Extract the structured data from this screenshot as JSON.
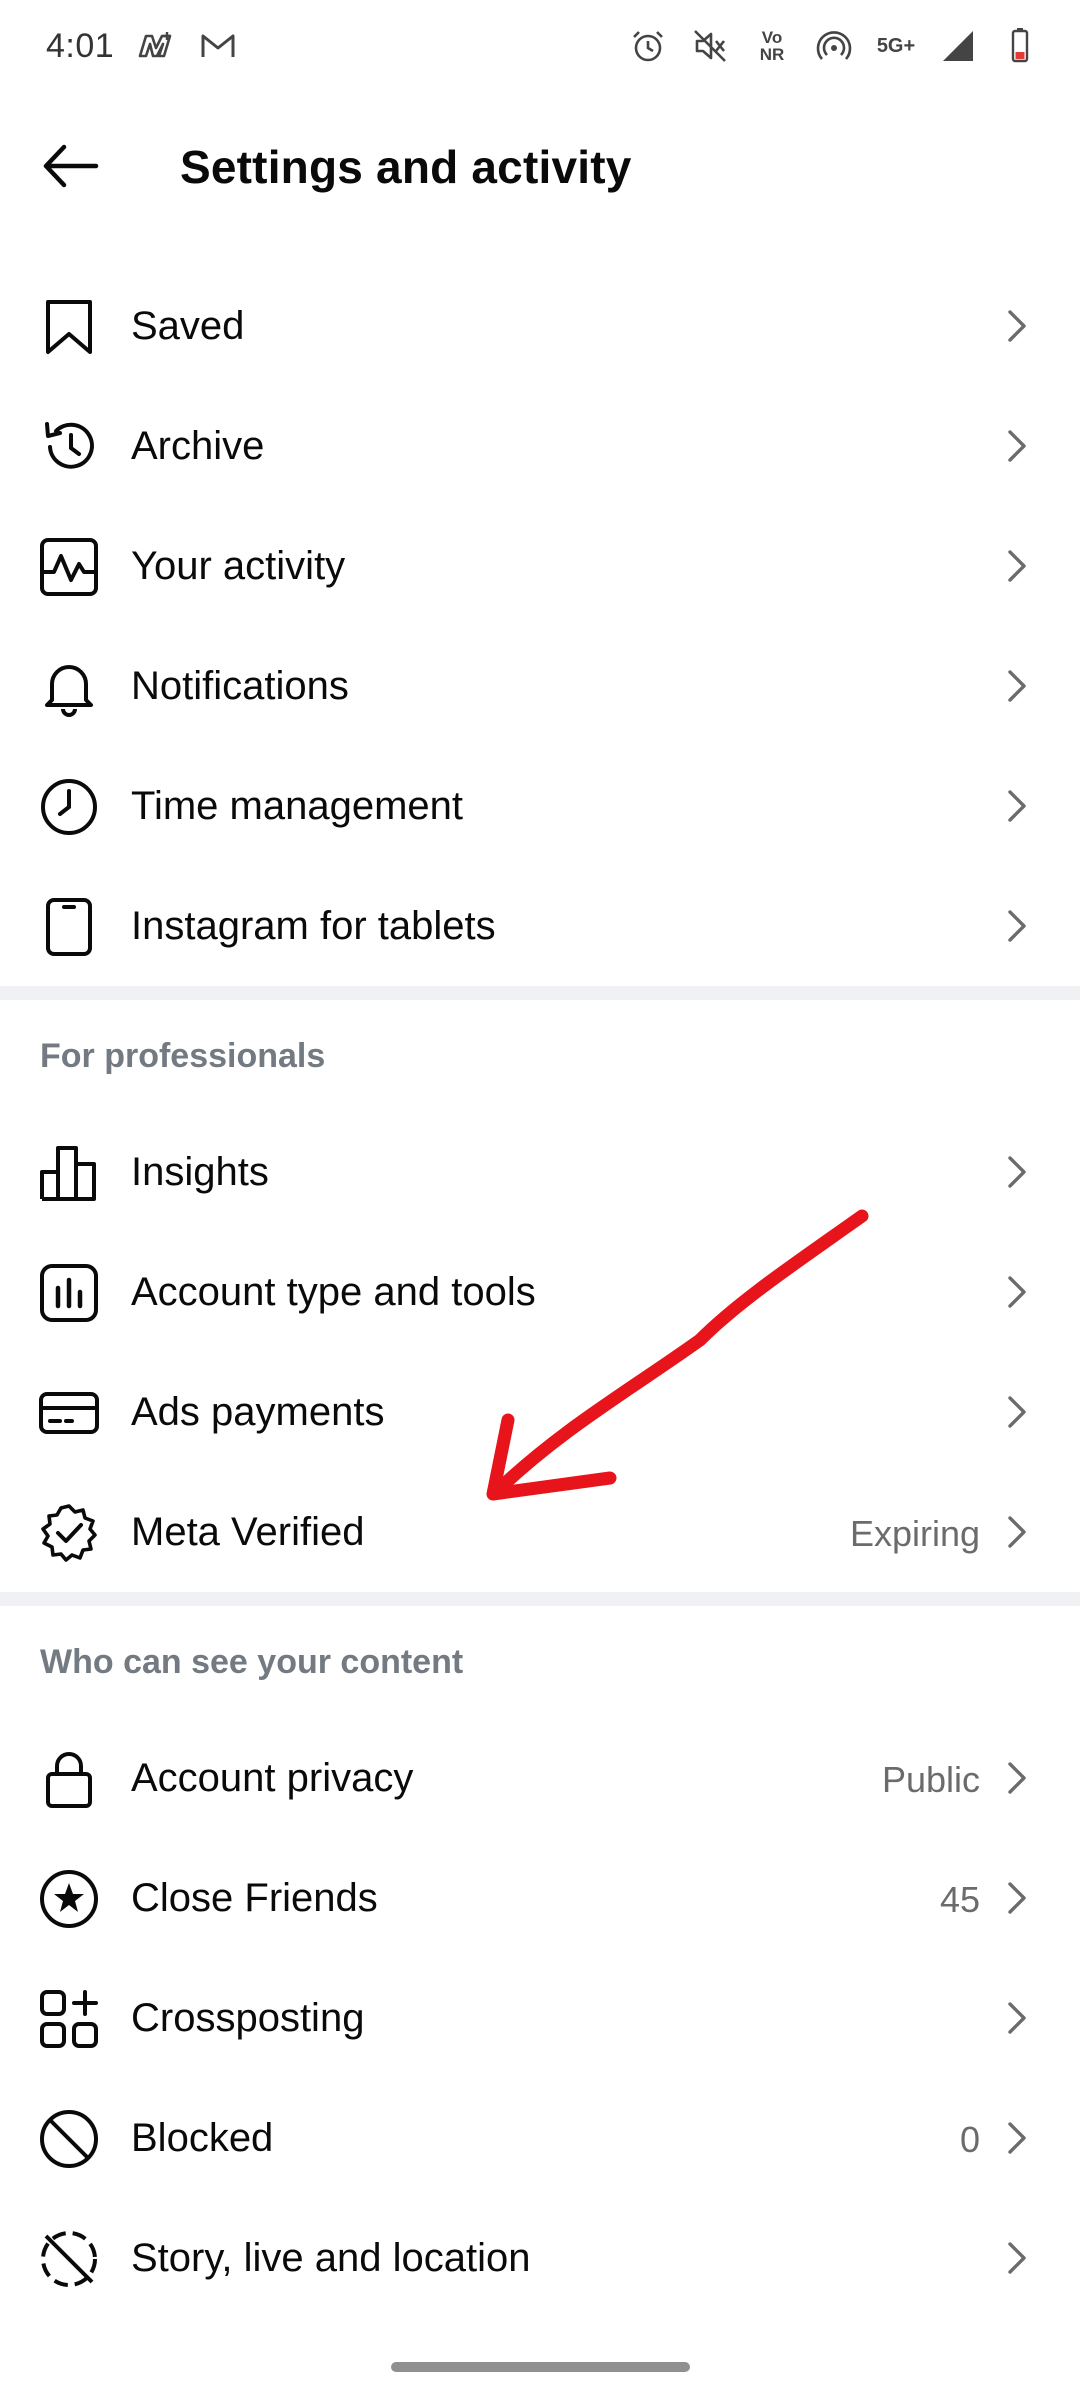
{
  "status_bar": {
    "time": "4:01",
    "vo_label": "Vo",
    "nr_label": "NR",
    "net_label": "5G+",
    "left_icons": [
      "mobile-m-icon",
      "gmail-icon"
    ],
    "right_icons": [
      "alarm-icon",
      "mute-icon",
      "volte-icon",
      "hotspot-icon",
      "5g-icon",
      "signal-icon",
      "battery-icon"
    ]
  },
  "header": {
    "title": "Settings and activity",
    "back_icon": "arrow-left-icon"
  },
  "items_main": [
    {
      "label": "Saved",
      "icon": "bookmark-icon"
    },
    {
      "label": "Archive",
      "icon": "archive-history-icon"
    },
    {
      "label": "Your activity",
      "icon": "activity-icon"
    },
    {
      "label": "Notifications",
      "icon": "bell-icon"
    },
    {
      "label": "Time management",
      "icon": "clock-icon"
    },
    {
      "label": "Instagram for tablets",
      "icon": "tablet-icon"
    }
  ],
  "section_professionals": {
    "heading": "For professionals",
    "items": [
      {
        "label": "Insights",
        "icon": "bar-chart-icon"
      },
      {
        "label": "Account type and tools",
        "icon": "account-tools-icon"
      },
      {
        "label": "Ads payments",
        "icon": "credit-card-icon"
      },
      {
        "label": "Meta Verified",
        "icon": "verified-badge-icon",
        "value": "Expiring"
      }
    ]
  },
  "section_content": {
    "heading": "Who can see your content",
    "items": [
      {
        "label": "Account privacy",
        "icon": "lock-icon",
        "value": "Public"
      },
      {
        "label": "Close Friends",
        "icon": "star-circle-icon",
        "value": "45"
      },
      {
        "label": "Crossposting",
        "icon": "crosspost-grid-icon"
      },
      {
        "label": "Blocked",
        "icon": "block-icon",
        "value": "0"
      },
      {
        "label": "Story, live and location",
        "icon": "story-off-icon"
      }
    ]
  },
  "annotation": {
    "arrow_color": "#e8141c"
  },
  "colors": {
    "accent_text": "#0a0a0a",
    "secondary_text": "#6b6b6b",
    "section_heading": "#737a82",
    "divider": "#eff1f5"
  }
}
